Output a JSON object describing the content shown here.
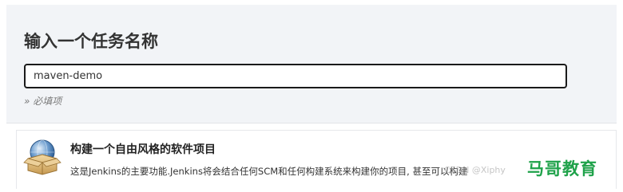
{
  "header": {
    "title": "输入一个任务名称"
  },
  "name_field": {
    "value": "maven-demo",
    "required_hint": "» 必填项"
  },
  "job_types": [
    {
      "title": "构建一个自由风格的软件项目",
      "description": "这是Jenkins的主要功能.Jenkins将会结合任何SCM和任何构建系统来构建你的项目, 甚至可以构建"
    }
  ],
  "watermarks": {
    "csdn": "CSDN @Xiphy",
    "brand": "马哥教育"
  },
  "colors": {
    "panel_bg": "#f2f4f7",
    "brand_green": "#1fa24a",
    "input_border": "#1a1a1a"
  },
  "icons": {
    "freestyle_job": "package-globe-icon"
  }
}
